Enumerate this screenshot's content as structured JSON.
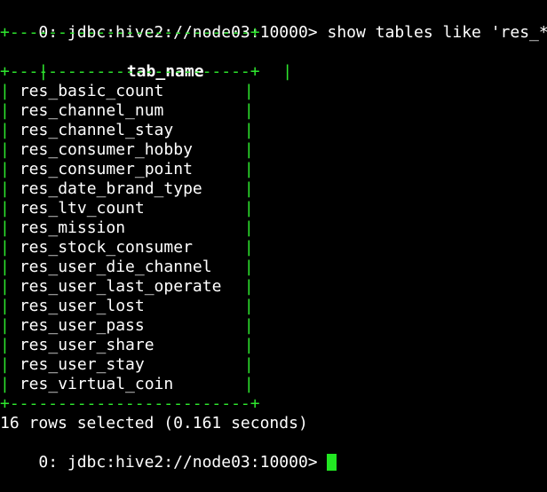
{
  "terminal": {
    "command_prompt": "0: jdbc:hive2://node03:10000>",
    "command_text": " show tables like 'res_*';",
    "border_top": "+-------------------------+",
    "header_cell": "tab_name",
    "border_mid": "+-------------------------+",
    "rows": [
      "res_basic_count",
      "res_channel_num",
      "res_channel_stay",
      "res_consumer_hobby",
      "res_consumer_point",
      "res_date_brand_type",
      "res_ltv_count",
      "res_mission",
      "res_stock_consumer",
      "res_user_die_channel",
      "res_user_last_operate",
      "res_user_lost",
      "res_user_pass",
      "res_user_share",
      "res_user_stay",
      "res_virtual_coin"
    ],
    "border_bottom": "+-------------------------+",
    "result_summary": "16 rows selected (0.161 seconds)",
    "final_prompt": "0: jdbc:hive2://node03:10000>",
    "pipe": "|"
  },
  "colors": {
    "background": "#000000",
    "text": "#ffffff",
    "border": "#2ee82e",
    "cursor": "#22e622"
  }
}
